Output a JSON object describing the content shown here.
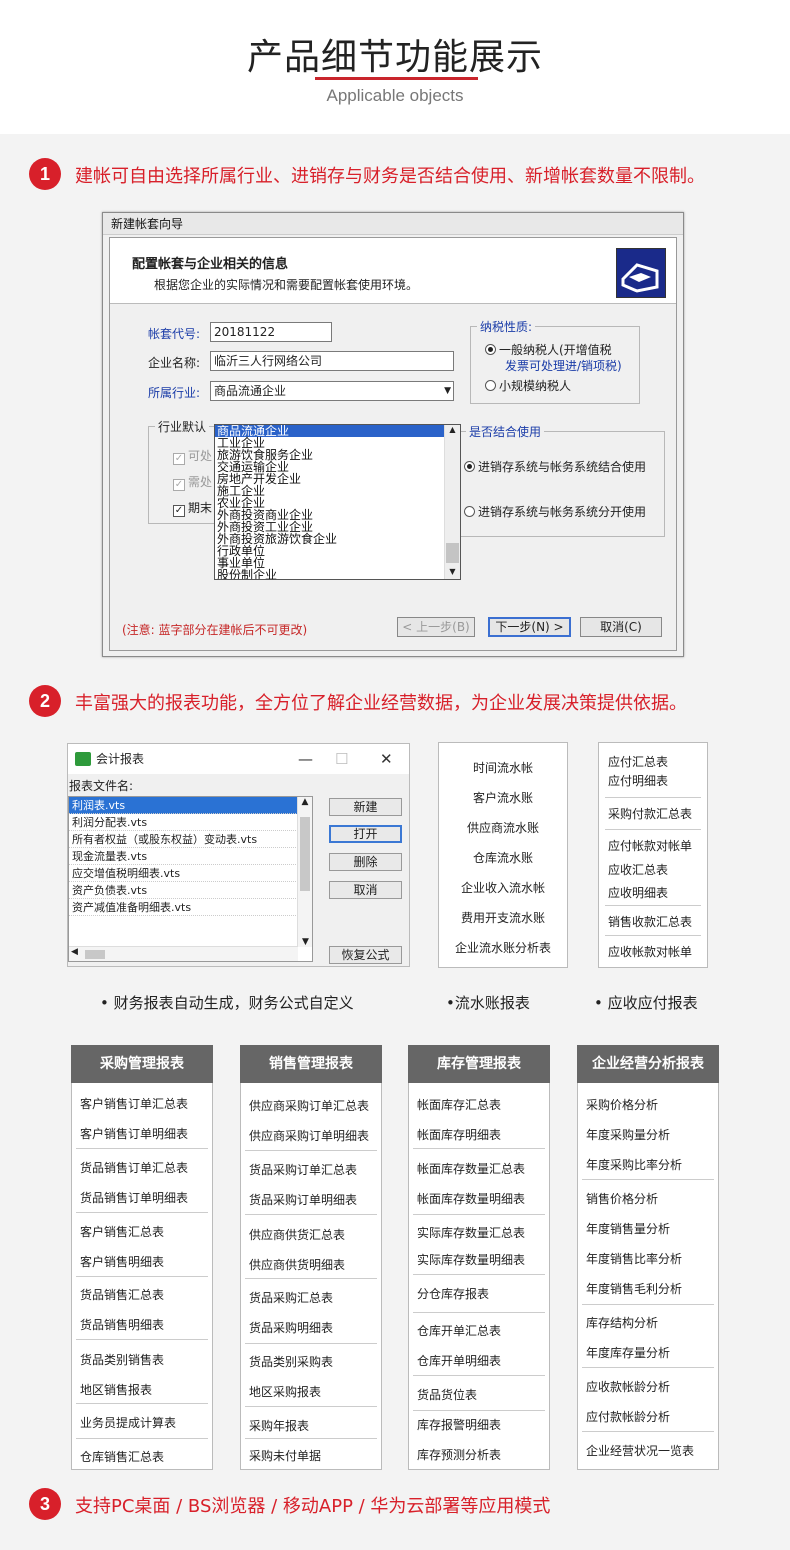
{
  "header": {
    "title": "产品细节功能展示",
    "subtitle": "Applicable objects"
  },
  "sections": [
    {
      "num": "1",
      "text": "建帐可自由选择所属行业、进销存与财务是否结合使用、新增帐套数量不限制。"
    },
    {
      "num": "2",
      "text": "丰富强大的报表功能，全方位了解企业经营数据，为企业发展决策提供依据。"
    },
    {
      "num": "3",
      "text": "支持PC桌面 / BS浏览器 / 移动APP / 华为云部署等应用模式"
    }
  ],
  "wizard": {
    "window_title": "新建帐套向导",
    "heading": "配置帐套与企业相关的信息",
    "subheading": "根据您企业的实际情况和需要配置帐套使用环境。",
    "code_label": "帐套代号:",
    "code_value": "20181122",
    "name_label": "企业名称:",
    "name_value": "临沂三人行网络公司",
    "industry_label": "所属行业:",
    "industry_value": "商品流通企业",
    "industry_options": [
      "商品流通企业",
      "工业企业",
      "旅游饮食服务企业",
      "交通运输企业",
      "房地产开发企业",
      "施工企业",
      "农业企业",
      "外商投资商业企业",
      "外商投资工业企业",
      "外商投资旅游饮食企业",
      "行政单位",
      "事业单位",
      "股份制企业"
    ],
    "tax_group": "纳税性质:",
    "tax_general": "一般纳税人(开增值税",
    "tax_general_2": "发票可处理进/销项税)",
    "tax_small": "小规模纳税人",
    "default_group": "行业默认",
    "chk1": "可处",
    "chk2": "需处",
    "chk3": "期末",
    "combine_group": "是否结合使用",
    "combine_on": "进销存系统与帐务系统结合使用",
    "combine_off": "进销存系统与帐务系统分开使用",
    "note": "(注意: 蓝字部分在建帐后不可更改)",
    "btn_prev": "< 上一步(B)",
    "btn_next": "下一步(N) >",
    "btn_cancel": "取消(C)"
  },
  "report_window": {
    "title": "会计报表",
    "ctl_min": "—",
    "ctl_max": "☐",
    "ctl_close": "✕",
    "list_label": "报表文件名:",
    "files": [
      "利润表.vts",
      "利润分配表.vts",
      "所有者权益（或股东权益）变动表.vts",
      "现金流量表.vts",
      "应交增值税明细表.vts",
      "资产负债表.vts",
      "资产减值准备明细表.vts"
    ],
    "btn_new": "新建",
    "btn_open": "打开",
    "btn_delete": "删除",
    "btn_cancel": "取消",
    "btn_restore": "恢复公式"
  },
  "journal_box": [
    "时间流水帐",
    "客户流水账",
    "供应商流水账",
    "仓库流水账",
    "企业收入流水帐",
    "费用开支流水账",
    "企业流水账分析表"
  ],
  "ar_ap_box": [
    "应付汇总表",
    "应付明细表",
    "采购付款汇总表",
    "应付帐款对帐单",
    "应收汇总表",
    "应收明细表",
    "销售收款汇总表",
    "应收帐款对帐单"
  ],
  "captions": {
    "c1": "• 财务报表自动生成，财务公式自定义",
    "c2": "•流水账报表",
    "c3": "• 应收应付报表"
  },
  "columns": [
    {
      "title": "采购管理报表",
      "items": [
        "客户销售订单汇总表",
        "客户销售订单明细表",
        "货品销售订单汇总表",
        "货品销售订单明细表",
        "客户销售汇总表",
        "客户销售明细表",
        "货品销售汇总表",
        "货品销售明细表",
        "货品类别销售表",
        "地区销售报表",
        "业务员提成计算表",
        "仓库销售汇总表"
      ]
    },
    {
      "title": "销售管理报表",
      "items": [
        "供应商采购订单汇总表",
        "供应商采购订单明细表",
        "货品采购订单汇总表",
        "货品采购订单明细表",
        "供应商供货汇总表",
        "供应商供货明细表",
        "货品采购汇总表",
        "货品采购明细表",
        "货品类别采购表",
        "地区采购报表",
        "采购年报表",
        "采购未付单据"
      ]
    },
    {
      "title": "库存管理报表",
      "items": [
        "帐面库存汇总表",
        "帐面库存明细表",
        "帐面库存数量汇总表",
        "帐面库存数量明细表",
        "实际库存数量汇总表",
        "实际库存数量明细表",
        "分仓库存报表",
        "仓库开单汇总表",
        "仓库开单明细表",
        "货品货位表",
        "库存报警明细表",
        "库存预测分析表"
      ]
    },
    {
      "title": "企业经营分析报表",
      "items": [
        "采购价格分析",
        "年度采购量分析",
        "年度采购比率分析",
        "销售价格分析",
        "年度销售量分析",
        "年度销售比率分析",
        "年度销售毛利分析",
        "库存结构分析",
        "年度库存量分析",
        "应收款帐龄分析",
        "应付款帐龄分析",
        "企业经营状况一览表"
      ]
    }
  ],
  "colors": {
    "accent": "#d8202a",
    "header_gray": "#666666",
    "selection": "#2a62c9"
  }
}
